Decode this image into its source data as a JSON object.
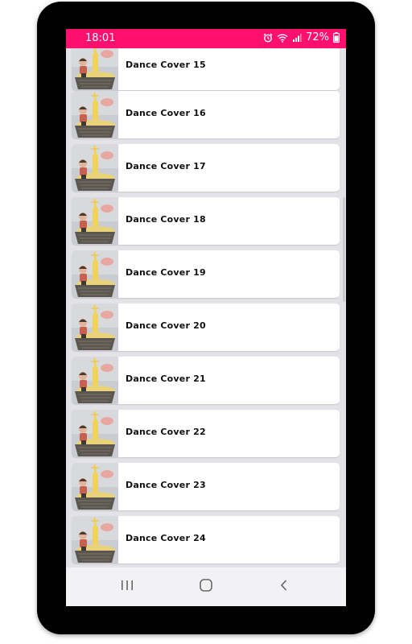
{
  "status_bar": {
    "time": "18:01",
    "battery": "72%",
    "color": "#ff0f6e",
    "icons": [
      "alarm-icon",
      "wifi-icon",
      "signal-icon",
      "battery-icon"
    ]
  },
  "list": {
    "items": [
      {
        "title": "Dance Cover 15"
      },
      {
        "title": "Dance Cover 16"
      },
      {
        "title": "Dance Cover 17"
      },
      {
        "title": "Dance Cover 18"
      },
      {
        "title": "Dance Cover 19"
      },
      {
        "title": "Dance Cover 20"
      },
      {
        "title": "Dance Cover 21"
      },
      {
        "title": "Dance Cover 22"
      },
      {
        "title": "Dance Cover 23"
      },
      {
        "title": "Dance Cover 24"
      }
    ]
  },
  "nav_bar": {
    "buttons": [
      "recents-icon",
      "home-icon",
      "back-icon"
    ]
  }
}
